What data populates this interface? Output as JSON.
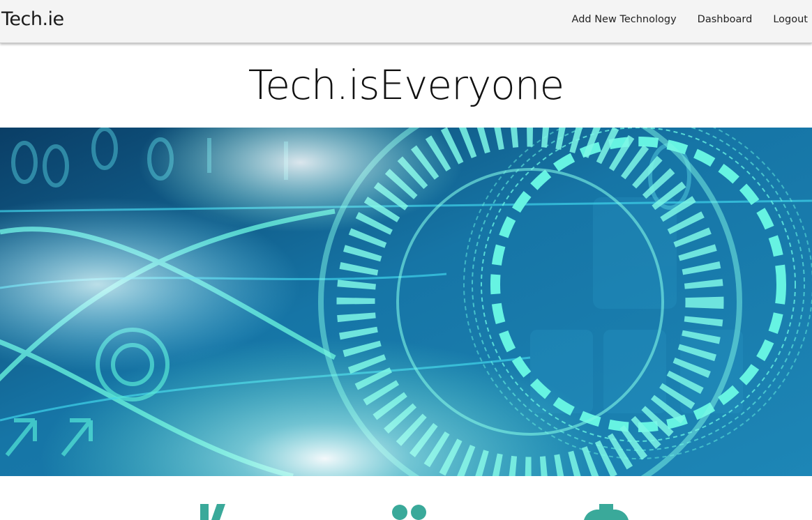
{
  "navbar": {
    "brand": "Tech.ie",
    "links": [
      {
        "label": "Add New Technology"
      },
      {
        "label": "Dashboard"
      },
      {
        "label": "Logout"
      }
    ]
  },
  "hero": {
    "title": "Tech.isEveryone"
  },
  "banner": {
    "image": "technology-circuit-banner",
    "colors": {
      "dark": "#0d4f7a",
      "mid": "#1b87b8",
      "accent": "#5ef2d6",
      "glow": "#eaffff"
    }
  },
  "features": {
    "icons": [
      "pencil-icon",
      "users-icon",
      "gear-icon"
    ],
    "accent": "#3aa99a"
  }
}
